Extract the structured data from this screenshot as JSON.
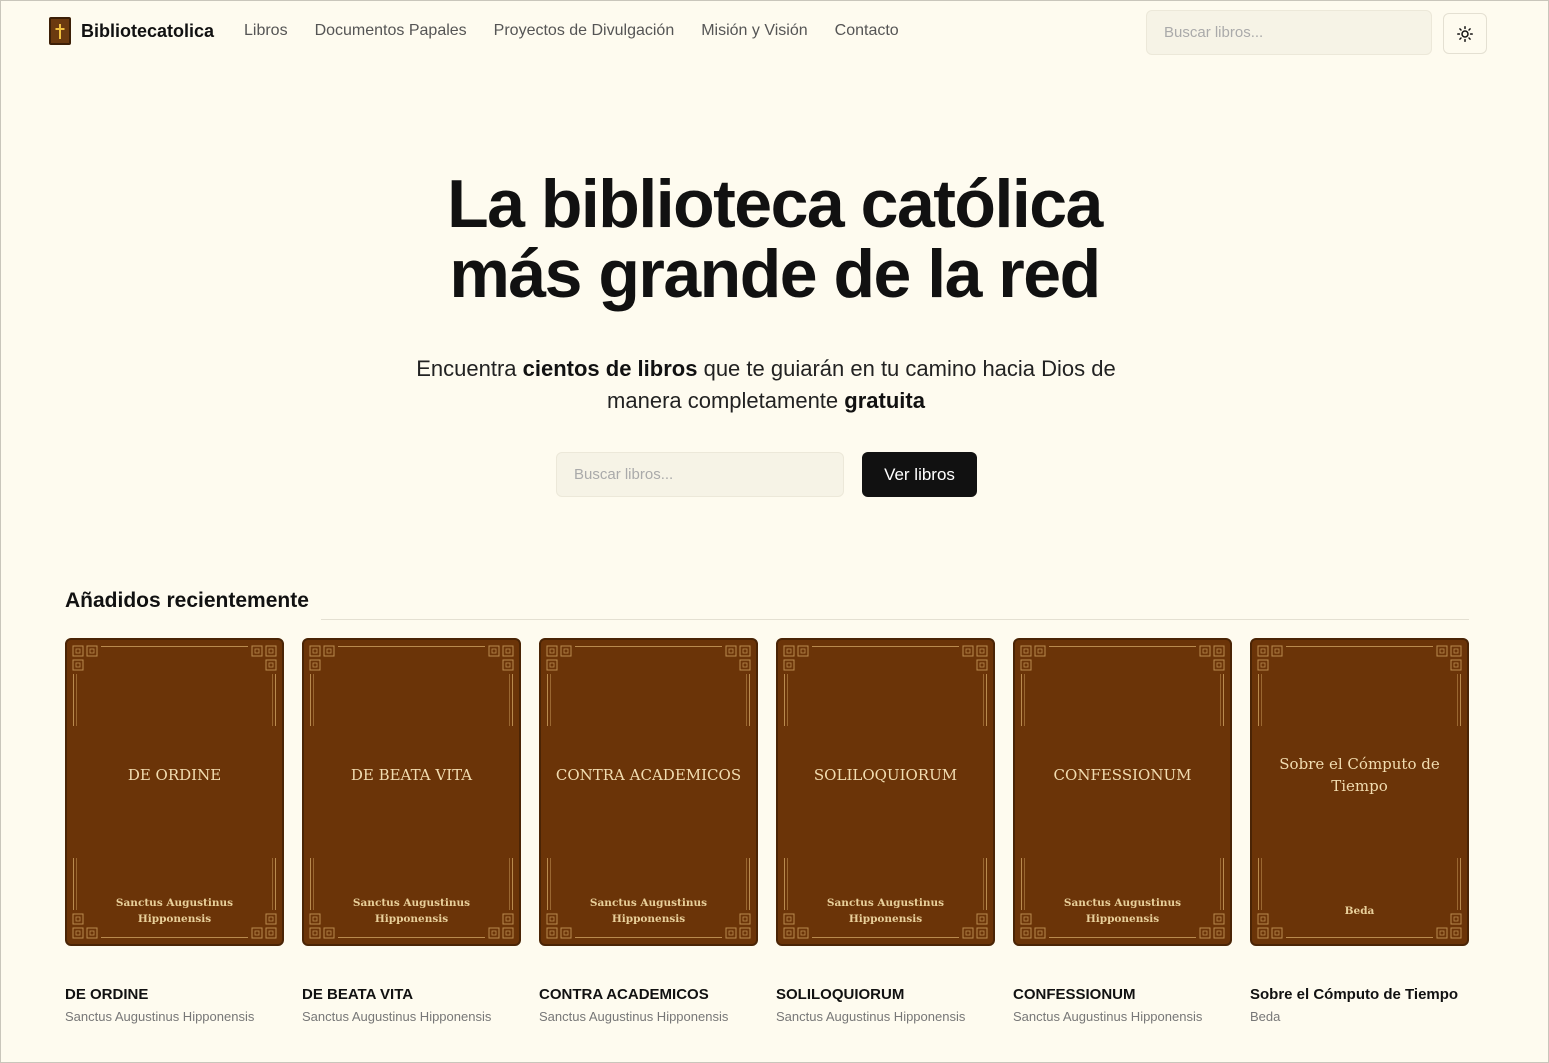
{
  "header": {
    "brand": "Bibliotecatolica",
    "nav": [
      "Libros",
      "Documentos Papales",
      "Proyectos de Divulgación",
      "Misión y Visión",
      "Contacto"
    ],
    "search_placeholder": "Buscar libros...",
    "theme_icon": "sun-icon"
  },
  "hero": {
    "title_line1": "La biblioteca católica",
    "title_line2": "más grande de la red",
    "sub_1": "Encuentra ",
    "sub_bold1": "cientos de libros",
    "sub_2": " que te guiarán en tu camino hacia Dios de manera completamente ",
    "sub_bold2": "gratuita",
    "search_placeholder": "Buscar libros...",
    "button": "Ver libros"
  },
  "recent": {
    "title": "Añadidos recientemente",
    "books": [
      {
        "cover_title": "DE ORDINE",
        "cover_author": "Sanctus Augustinus Hipponensis",
        "title": "DE ORDINE",
        "author": "Sanctus Augustinus Hipponensis"
      },
      {
        "cover_title": "DE BEATA VITA",
        "cover_author": "Sanctus Augustinus Hipponensis",
        "title": "DE BEATA VITA",
        "author": "Sanctus Augustinus Hipponensis"
      },
      {
        "cover_title": "CONTRA ACADEMICOS",
        "cover_author": "Sanctus Augustinus Hipponensis",
        "title": "CONTRA ACADEMICOS",
        "author": "Sanctus Augustinus Hipponensis"
      },
      {
        "cover_title": "SOLILOQUIORUM",
        "cover_author": "Sanctus Augustinus Hipponensis",
        "title": "SOLILOQUIORUM",
        "author": "Sanctus Augustinus Hipponensis"
      },
      {
        "cover_title": "CONFESSIONUM",
        "cover_author": "Sanctus Augustinus Hipponensis",
        "title": "CONFESSIONUM",
        "author": "Sanctus Augustinus Hipponensis"
      },
      {
        "cover_title": "Sobre el Cómputo de Tiempo",
        "cover_author": "Beda",
        "title": "Sobre el Cómputo de Tiempo",
        "author": "Beda"
      }
    ]
  },
  "colors": {
    "background": "#fefbef",
    "cover": "#6b3408",
    "cover_text": "#f1dcb0",
    "button": "#111111"
  }
}
